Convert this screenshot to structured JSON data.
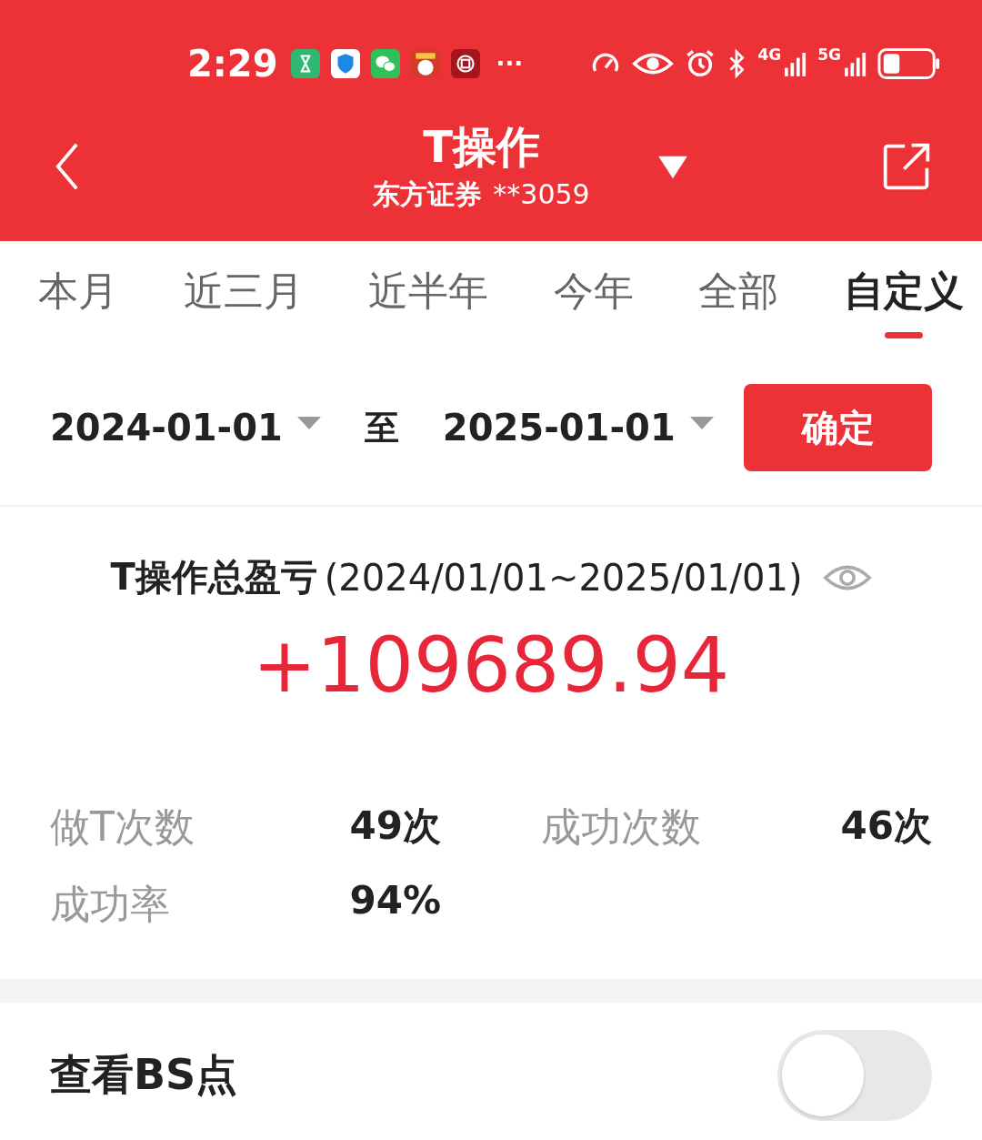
{
  "status_bar": {
    "time": "2:29",
    "more": "···",
    "network_1": "4G",
    "network_2": "5G"
  },
  "nav": {
    "title": "T操作",
    "account": "东方证券",
    "account_no": "**3059"
  },
  "tabs": [
    {
      "label": "本月",
      "selected": false
    },
    {
      "label": "近三月",
      "selected": false
    },
    {
      "label": "近半年",
      "selected": false
    },
    {
      "label": "今年",
      "selected": false
    },
    {
      "label": "全部",
      "selected": false
    },
    {
      "label": "自定义",
      "selected": true
    }
  ],
  "date_range": {
    "start": "2024-01-01",
    "separator": "至",
    "end": "2025-01-01",
    "confirm": "确定"
  },
  "summary": {
    "title": "T操作总盈亏",
    "period": "(2024/01/01~2025/01/01)",
    "total": "+109689.94"
  },
  "stats": [
    {
      "label": "做T次数",
      "value": "49次"
    },
    {
      "label": "成功次数",
      "value": "46次"
    },
    {
      "label": "成功率",
      "value": "94%"
    }
  ],
  "bs_toggle": {
    "label": "查看BS点",
    "on": false
  }
}
